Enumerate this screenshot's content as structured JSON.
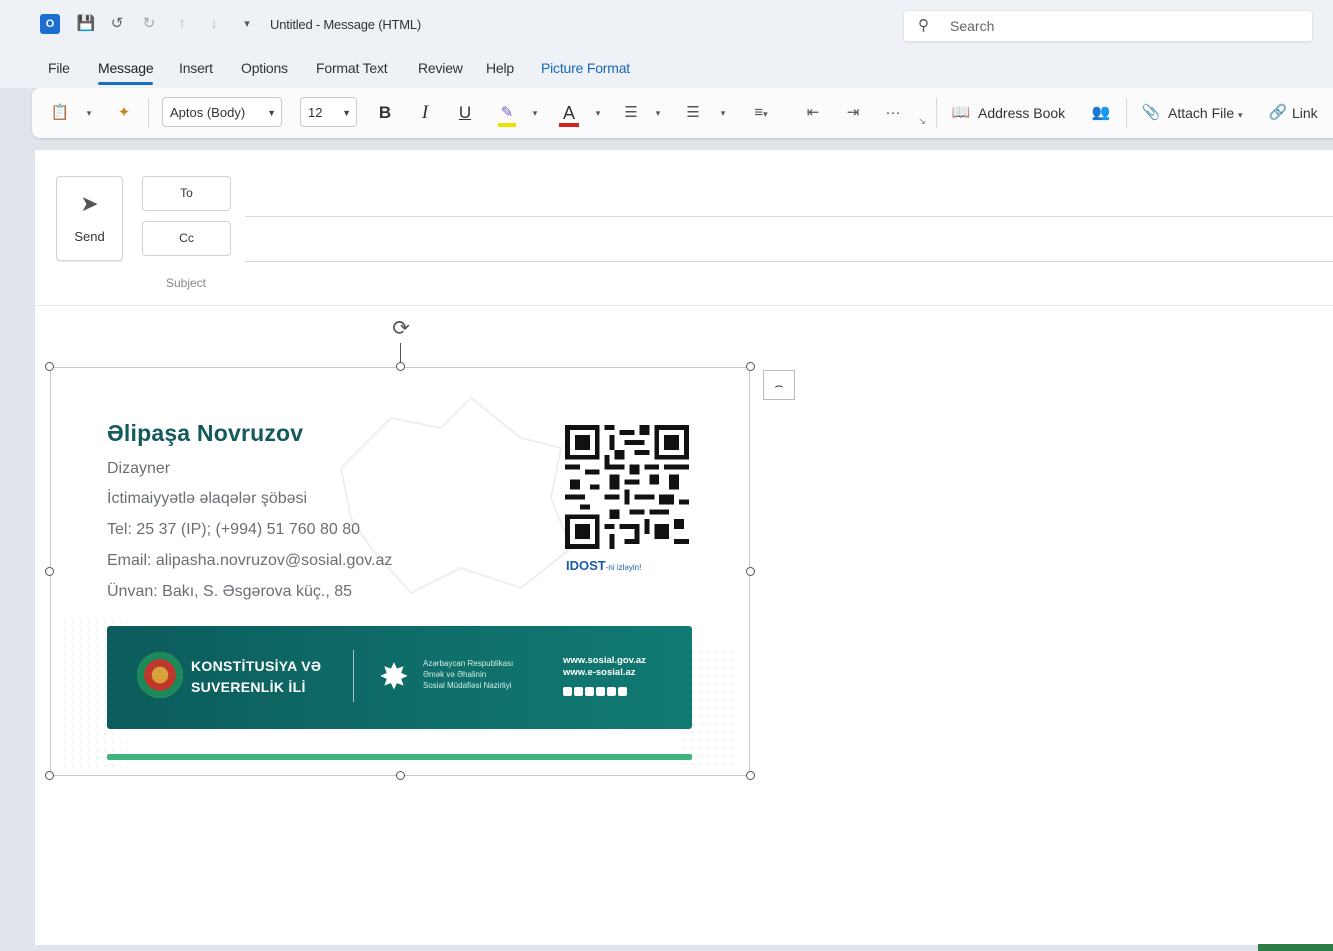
{
  "window": {
    "title": "Untitled - Message (HTML)",
    "search_placeholder": "Search"
  },
  "menu": {
    "tabs": [
      "File",
      "Message",
      "Insert",
      "Options",
      "Format Text",
      "Review",
      "Help",
      "Picture Format"
    ],
    "active_tab": "Message"
  },
  "ribbon": {
    "font_name": "Aptos (Body)",
    "font_size": "12",
    "bold": "B",
    "italic": "I",
    "underline": "U",
    "font_color_glyph": "A",
    "more": "···",
    "address_book": "Address Book",
    "attach_file": "Attach File",
    "link": "Link"
  },
  "compose": {
    "send_label": "Send",
    "to_label": "To",
    "cc_label": "Cc",
    "subject_label": "Subject"
  },
  "signature": {
    "name": "Əlipaşa Novruzov",
    "title": "Dizayner",
    "department": "İctimaiyyətlə əlaqələr şöbəsi",
    "phone": "Tel: 25 37 (IP); (+994) 51 760 80 80",
    "email": "Email: alipasha.novruzov@sosial.gov.az",
    "address": "Ünvan: Bakı, S. Əsgərova küç., 85",
    "qr_caption": "IDOST",
    "qr_caption_suffix": "-ni izləyin!",
    "banner_title_1": "KONSTİTUSİYA VƏ",
    "banner_title_2": "SUVERENLİK İLİ",
    "ministry_1": "Azərbaycan Respublikası",
    "ministry_2": "Əmək və Əhalinin",
    "ministry_3": "Sosial Müdafiəsi Nazirliyi",
    "web_1": "www.sosial.gov.az",
    "web_2": "www.e-sosial.az"
  },
  "colors": {
    "accent": "#1b6dc1",
    "name_color": "#145a5b",
    "banner": "#0f6e69",
    "green_bar": "#3fb47f"
  }
}
